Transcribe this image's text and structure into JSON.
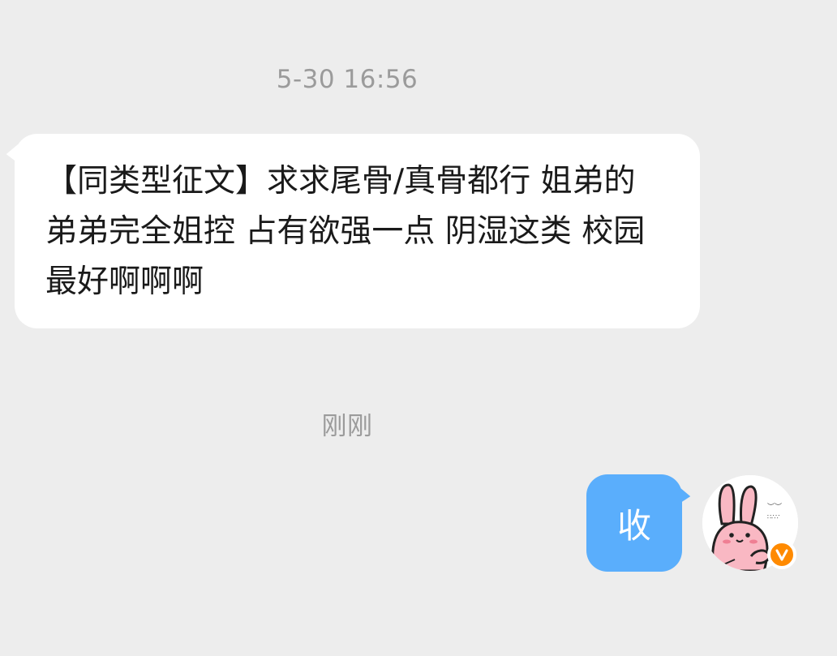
{
  "conversation": {
    "timestamp_1": "5-30 16:56",
    "incoming_message": "【同类型征文】求求尾骨/真骨都行 姐弟的 弟弟完全姐控 占有欲强一点 阴湿这类 校园最好啊啊啊",
    "timestamp_2": "刚刚",
    "outgoing_message": "收"
  },
  "user": {
    "avatar_icon": "pink-rabbit-avatar-icon",
    "badge_icon": "verified-v-badge-icon"
  },
  "colors": {
    "background": "#ededed",
    "incoming_bubble": "#ffffff",
    "outgoing_bubble": "#5aaefc",
    "timestamp_text": "#9b9b9b",
    "badge": "#ff8a00",
    "rabbit_pink": "#f9b8c3"
  }
}
